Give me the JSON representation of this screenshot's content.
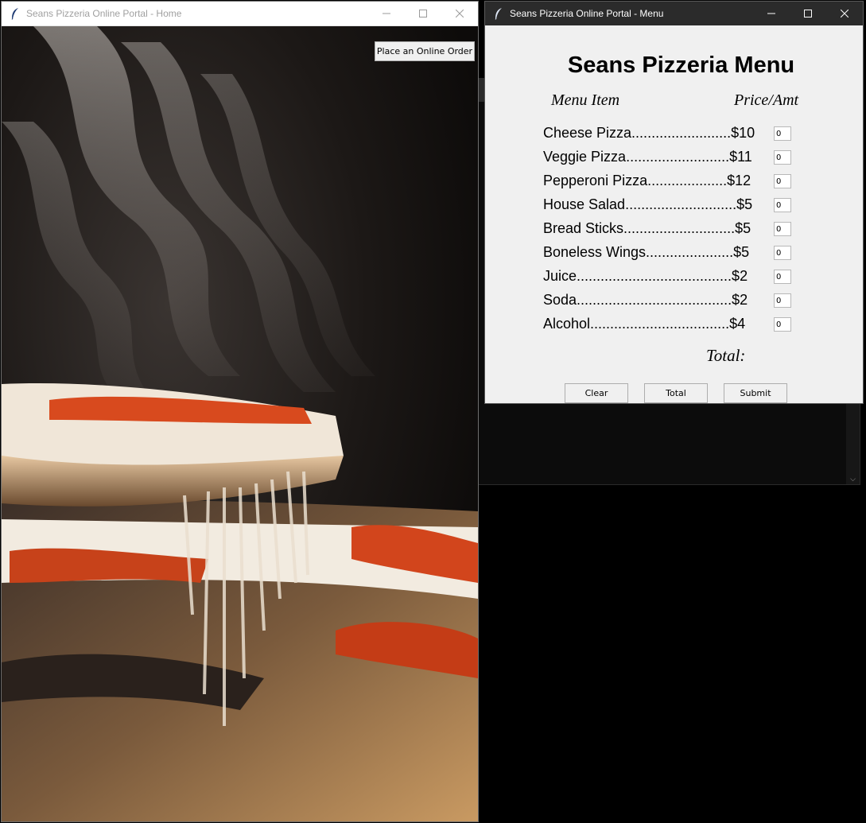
{
  "home": {
    "title": "Seans Pizzeria Online Portal - Home",
    "order_button": "Place an Online Order",
    "photo_subject": "steaming pizza slice with stretching cheese"
  },
  "menu": {
    "title": "Seans Pizzeria Online Portal - Menu",
    "heading": "Seans Pizzeria Menu",
    "col_item": "Menu Item",
    "col_price": "Price/Amt",
    "items": [
      {
        "label": "Cheese Pizza.........................$10",
        "qty": "0"
      },
      {
        "label": "Veggie Pizza..........................$11",
        "qty": "0"
      },
      {
        "label": "Pepperoni Pizza....................$12",
        "qty": "0"
      },
      {
        "label": "House Salad............................$5",
        "qty": "0"
      },
      {
        "label": "Bread Sticks............................$5",
        "qty": "0"
      },
      {
        "label": "Boneless Wings......................$5",
        "qty": "0"
      },
      {
        "label": "Juice.......................................$2",
        "qty": "0"
      },
      {
        "label": "Soda.......................................$2",
        "qty": "0"
      },
      {
        "label": "Alcohol...................................$4",
        "qty": "0"
      }
    ],
    "total_label": "Total:",
    "buttons": {
      "clear": "Clear",
      "total": "Total",
      "submit": "Submit"
    }
  },
  "icons": {
    "app_icon": "feather-icon",
    "minimize": "minimize-icon",
    "maximize": "maximize-icon",
    "close": "close-icon"
  }
}
